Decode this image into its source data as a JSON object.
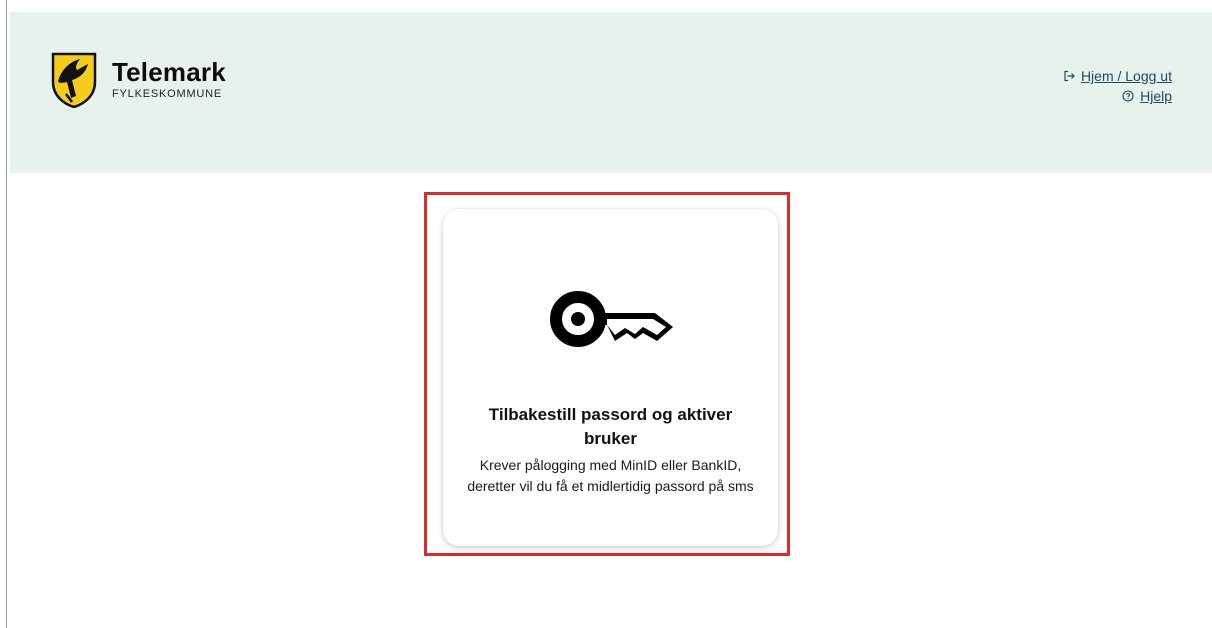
{
  "header": {
    "brand_name": "Telemark",
    "brand_sub": "FYLKESKOMMUNE",
    "links": [
      {
        "label": "Hjem / Logg ut",
        "icon": "logout-icon"
      },
      {
        "label": "Hjelp",
        "icon": "help-circle-icon"
      }
    ]
  },
  "card": {
    "icon": "key-icon",
    "title": "Tilbakestill passord og aktiver bruker",
    "description": "Krever pålogging med MinID eller BankID, deretter vil du få et midlertidig passord på sms"
  },
  "colors": {
    "header_bg": "#e8f2ec",
    "link": "#1d4a5c",
    "highlight": "#d92c2c",
    "crest_yellow": "#f5cc1e"
  }
}
